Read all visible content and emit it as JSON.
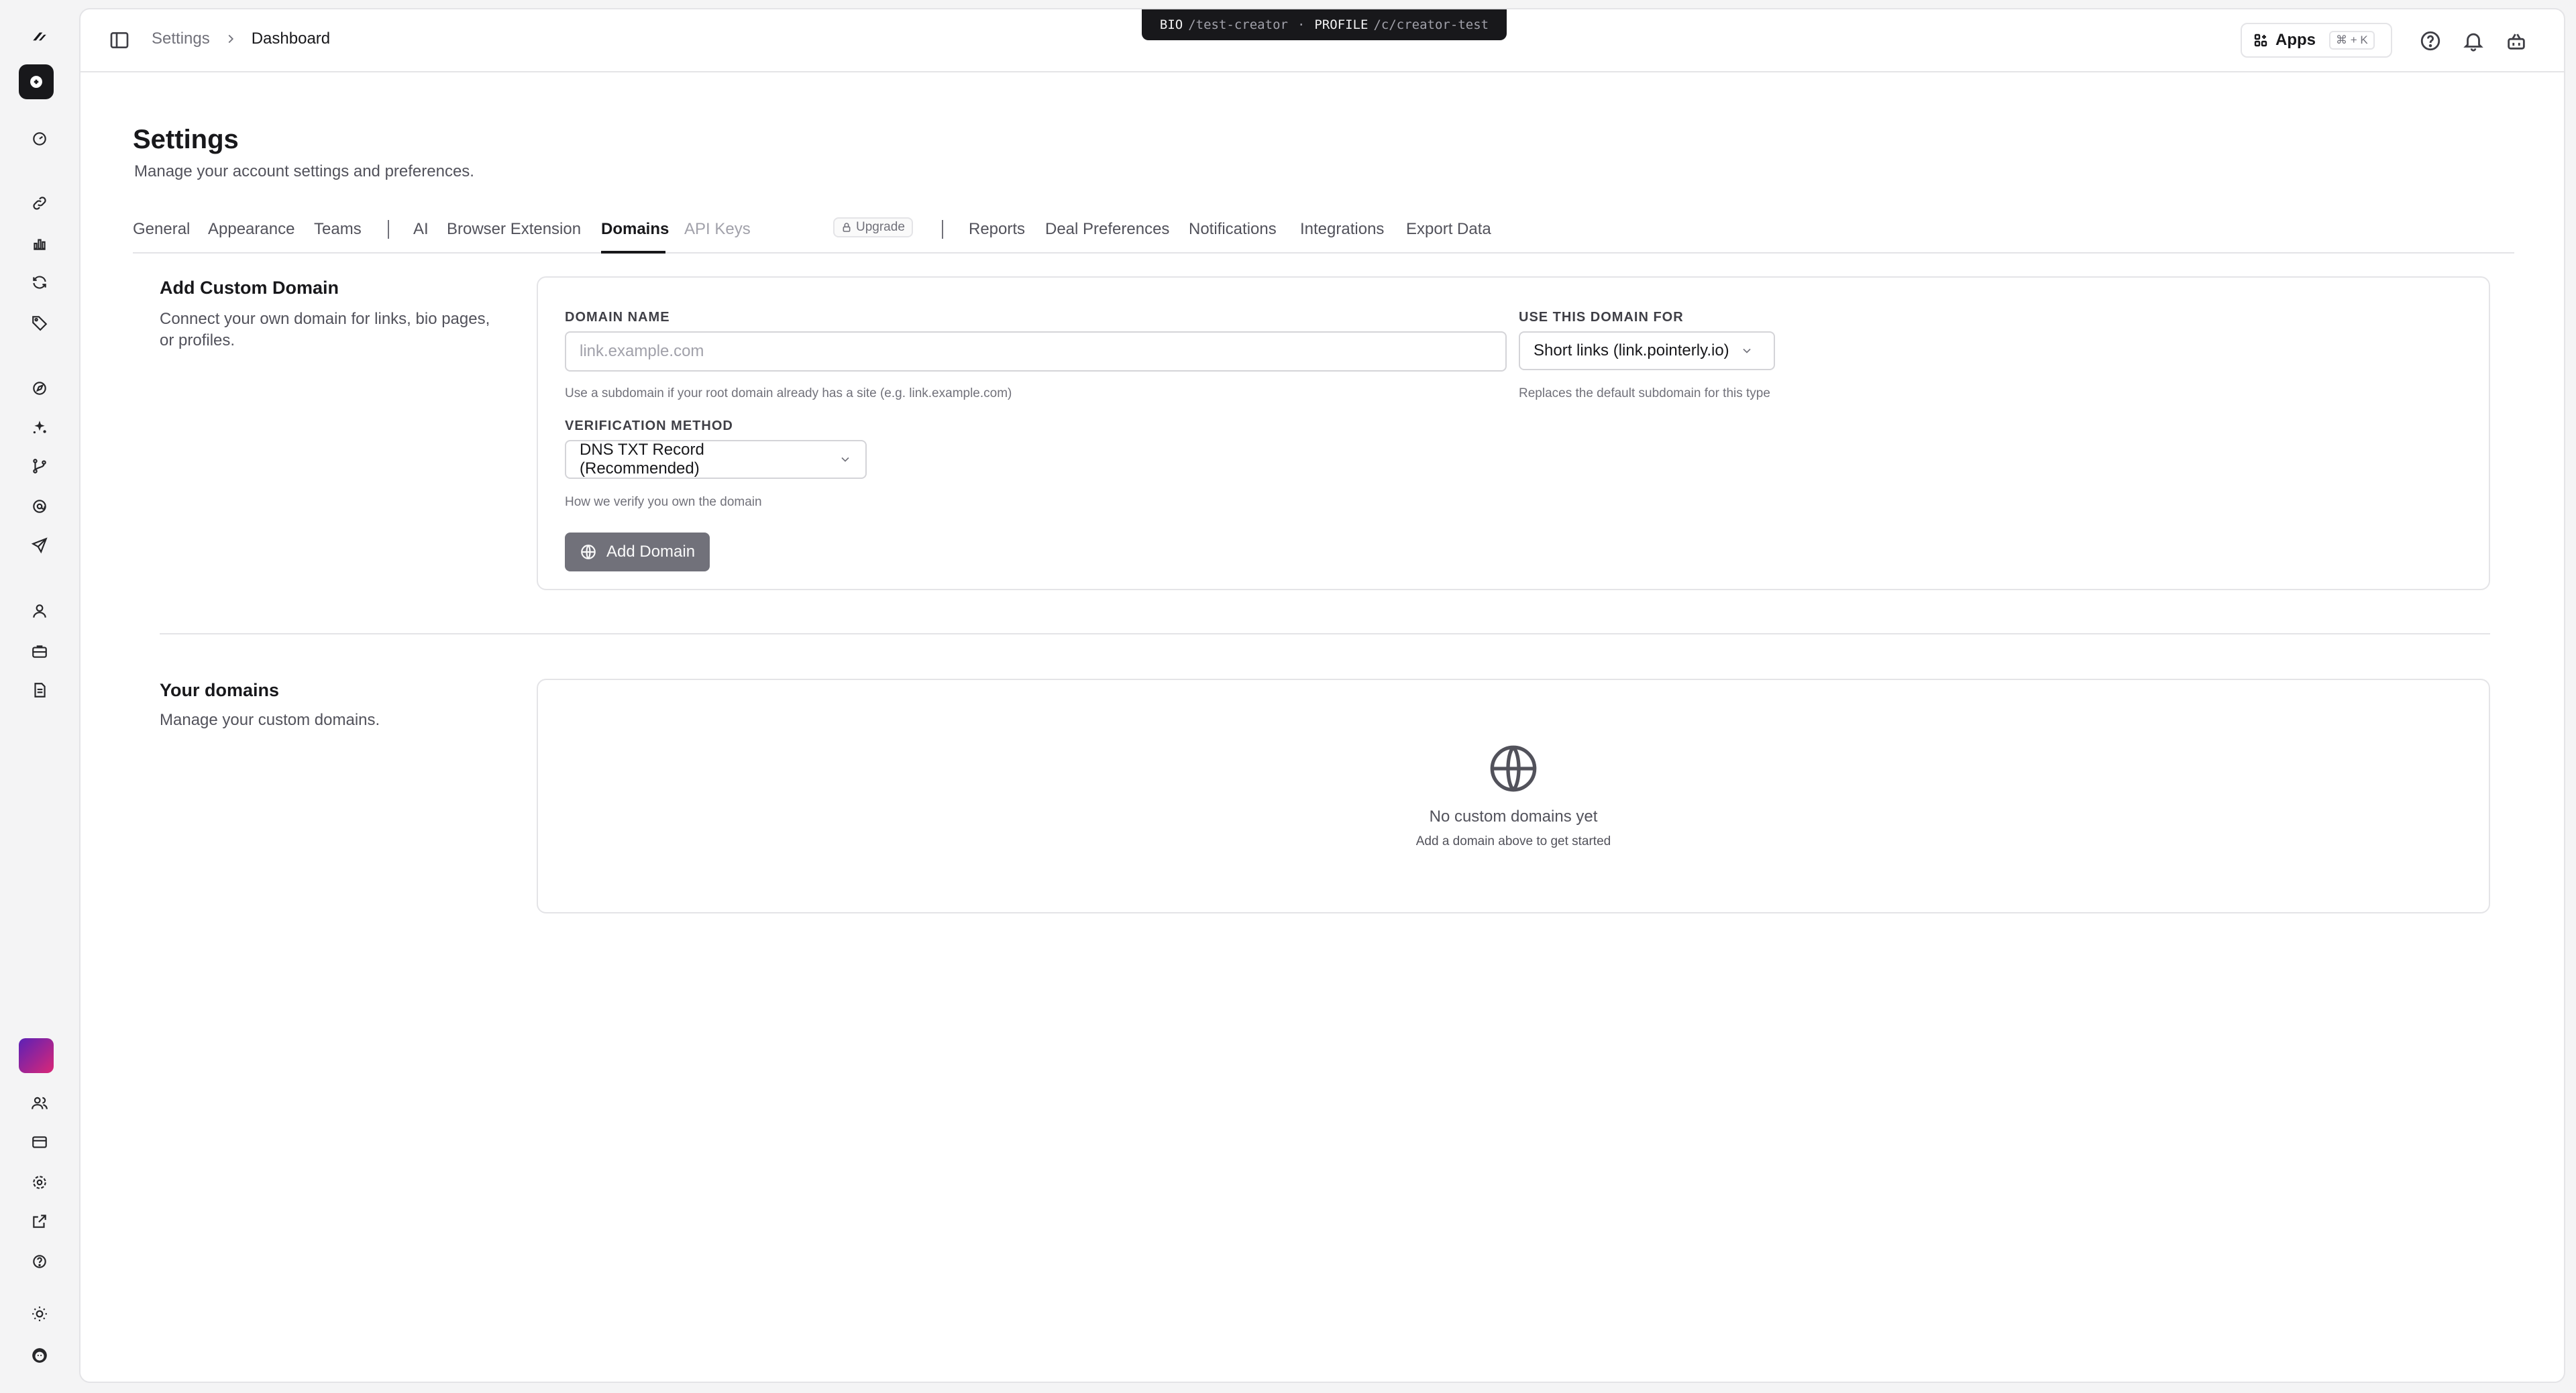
{
  "env_pill": {
    "bio_label": "BIO",
    "bio_path": "/test-creator",
    "separator": "·",
    "profile_label": "PROFILE",
    "profile_path": "/c/creator-test"
  },
  "breadcrumb": {
    "parent": "Settings",
    "current": "Dashboard"
  },
  "apps": {
    "label": "Apps",
    "shortcut": "⌘ + K"
  },
  "page": {
    "title": "Settings",
    "subtitle": "Manage your account settings and preferences."
  },
  "tabs": [
    {
      "label": "General"
    },
    {
      "label": "Appearance"
    },
    {
      "label": "Teams"
    },
    {
      "label": "AI"
    },
    {
      "label": "Browser Extension"
    },
    {
      "label": "Domains"
    },
    {
      "label": "API Keys"
    },
    {
      "label": "Reports"
    },
    {
      "label": "Deal Preferences"
    },
    {
      "label": "Notifications"
    },
    {
      "label": "Integrations"
    },
    {
      "label": "Export Data"
    }
  ],
  "upgrade_badge": "Upgrade",
  "add_domain_section": {
    "title": "Add Custom Domain",
    "desc_line1": "Connect your own domain for links, bio pages,",
    "desc_line2": "or profiles.",
    "domain_name_label": "DOMAIN NAME",
    "domain_name_placeholder": "link.example.com",
    "domain_name_hint": "Use a subdomain if your root domain already has a site (e.g. link.example.com)",
    "use_for_label": "USE THIS DOMAIN FOR",
    "use_for_value": "Short links (link.pointerly.io)",
    "use_for_hint": "Replaces the default subdomain for this type",
    "verification_label": "VERIFICATION METHOD",
    "verification_value": "DNS TXT Record (Recommended)",
    "verification_hint": "How we verify you own the domain",
    "add_button": "Add Domain"
  },
  "your_domains_section": {
    "title": "Your domains",
    "desc": "Manage your custom domains.",
    "empty_title": "No custom domains yet",
    "empty_sub": "Add a domain above to get started"
  },
  "icons": {
    "rail": [
      "logo-icon",
      "new-icon",
      "dashboard-icon",
      "link-icon",
      "chart-icon",
      "refresh-icon",
      "tag-icon",
      "compass-icon",
      "sparkle-icon",
      "branch-icon",
      "at-sign-icon",
      "send-icon",
      "user-icon",
      "briefcase-icon",
      "document-icon",
      "users-icon",
      "card-icon",
      "settings-icon",
      "export-icon",
      "help-icon",
      "sun-icon"
    ],
    "top": [
      "sidebar-toggle-icon",
      "help-icon",
      "bell-icon",
      "basket-icon"
    ]
  },
  "colors": {
    "primary": "#18181b",
    "muted": "#71717a",
    "border": "#e4e4e7",
    "button_disabled": "#71717a",
    "avatar_gradient_start": "#5b21b6",
    "avatar_gradient_end": "#db2777"
  }
}
